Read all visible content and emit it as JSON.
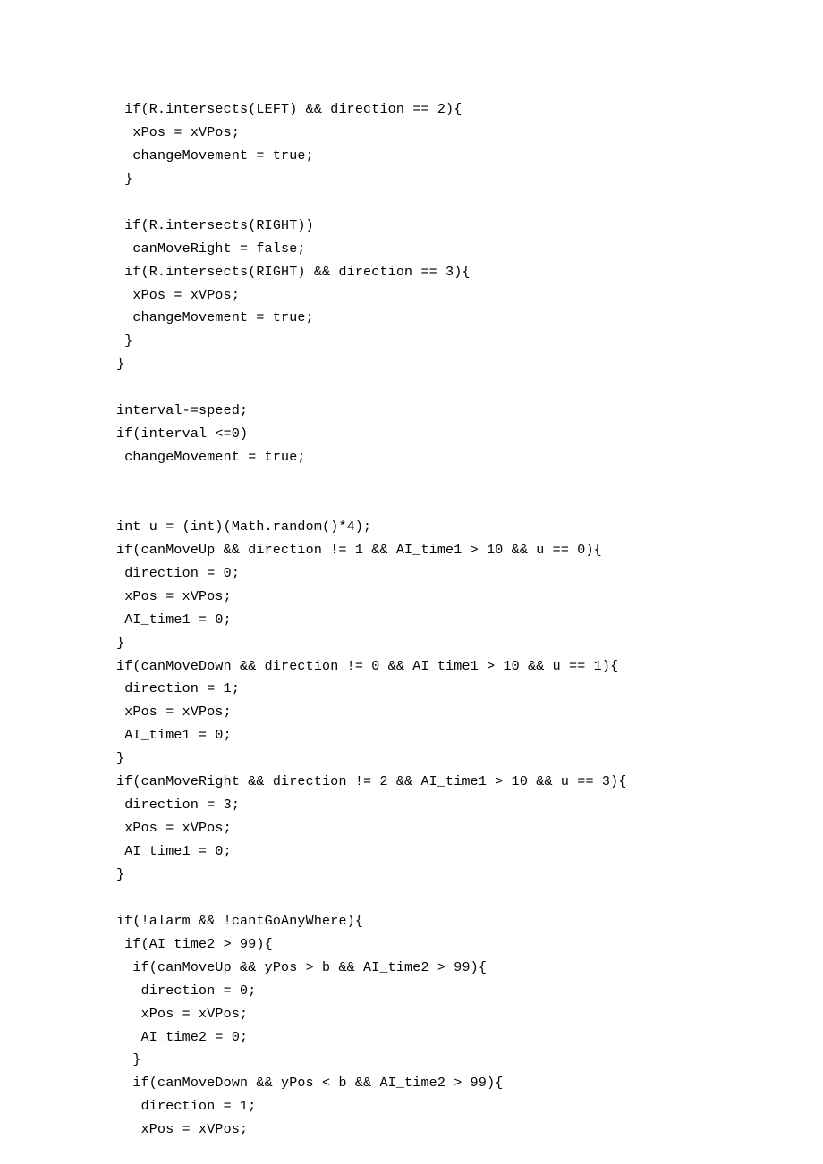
{
  "code": {
    "lines": [
      " if(R.intersects(LEFT) && direction == 2){",
      "  xPos = xVPos;",
      "  changeMovement = true;",
      " }",
      "",
      " if(R.intersects(RIGHT))",
      "  canMoveRight = false;",
      " if(R.intersects(RIGHT) && direction == 3){",
      "  xPos = xVPos;",
      "  changeMovement = true;",
      " }",
      "}",
      "",
      "interval-=speed;",
      "if(interval <=0)",
      " changeMovement = true;",
      "",
      "",
      "int u = (int)(Math.random()*4);",
      "if(canMoveUp && direction != 1 && AI_time1 > 10 && u == 0){",
      " direction = 0;",
      " xPos = xVPos;",
      " AI_time1 = 0;",
      "}",
      "if(canMoveDown && direction != 0 && AI_time1 > 10 && u == 1){",
      " direction = 1;",
      " xPos = xVPos;",
      " AI_time1 = 0;",
      "}",
      "if(canMoveRight && direction != 2 && AI_time1 > 10 && u == 3){",
      " direction = 3;",
      " xPos = xVPos;",
      " AI_time1 = 0;",
      "}",
      "",
      "if(!alarm && !cantGoAnyWhere){",
      " if(AI_time2 > 99){",
      "  if(canMoveUp && yPos > b && AI_time2 > 99){",
      "   direction = 0;",
      "   xPos = xVPos;",
      "   AI_time2 = 0;",
      "  }",
      "  if(canMoveDown && yPos < b && AI_time2 > 99){",
      "   direction = 1;",
      "   xPos = xVPos;"
    ]
  }
}
